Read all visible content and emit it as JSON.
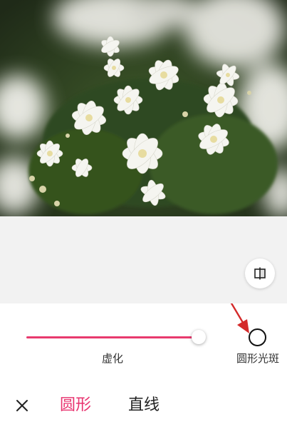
{
  "colors": {
    "accent": "#e8326e",
    "text": "#333333",
    "preview_bg": "#f2f2f2"
  },
  "photo": {
    "subject": "white-flowers-photo"
  },
  "compare_button": {
    "icon": "compare-split-icon"
  },
  "blur_slider": {
    "label": "虚化",
    "value_fraction": 0.97
  },
  "bokeh_option": {
    "label": "圆形光斑",
    "icon": "circle-outline-icon"
  },
  "annotation_arrow": {
    "color": "#d42a2a"
  },
  "bottom_bar": {
    "close_icon": "close-icon",
    "tabs": [
      {
        "label": "圆形",
        "selected": true
      },
      {
        "label": "直线",
        "selected": false
      }
    ]
  }
}
